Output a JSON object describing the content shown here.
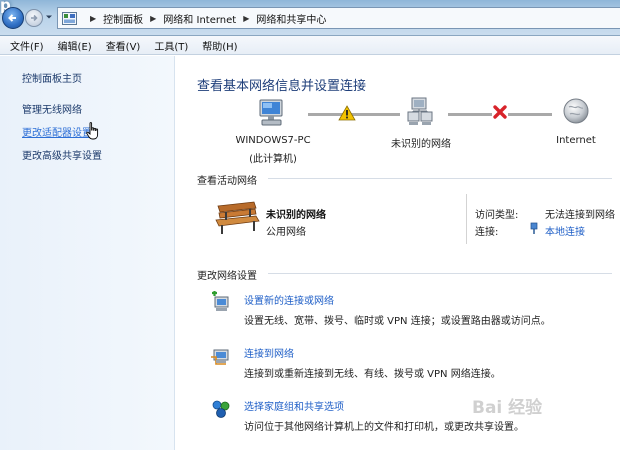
{
  "window": {
    "title_fragment": "p"
  },
  "address_bar": {
    "crumbs": [
      "控制面板",
      "网络和 Internet",
      "网络和共享中心"
    ],
    "icons": [
      "back-arrow-icon",
      "forward-arrow-icon",
      "control-panel-icon"
    ]
  },
  "menu": {
    "items": [
      "文件(F)",
      "编辑(E)",
      "查看(V)",
      "工具(T)",
      "帮助(H)"
    ]
  },
  "sidebar": {
    "items": [
      {
        "label": "控制面板主页"
      },
      {
        "label": "管理无线网络"
      },
      {
        "label": "更改适配器设置",
        "hovered": true
      },
      {
        "label": "更改高级共享设置"
      }
    ]
  },
  "main": {
    "title": "查看基本网络信息并设置连接",
    "map": {
      "nodes": [
        {
          "line1": "WINDOWS7-PC",
          "line2": "(此计算机)",
          "icon": "computer-icon"
        },
        {
          "line1": "未识别的网络",
          "icon": "network-icon"
        },
        {
          "line1": "Internet",
          "icon": "globe-icon"
        }
      ],
      "link_status": [
        {
          "icon": "warning-icon",
          "color": "#f2c200"
        },
        {
          "icon": "error-x-icon",
          "color": "#d8232a"
        }
      ]
    },
    "active": {
      "heading": "查看活动网络",
      "network_name": "未识别的网络",
      "network_type": "公用网络",
      "access_label": "访问类型:",
      "access_value": "无法连接到网络",
      "conn_label": "连接:",
      "conn_value": "本地连接"
    },
    "settings": {
      "heading": "更改网络设置",
      "tasks": [
        {
          "link": "设置新的连接或网络",
          "desc": "设置无线、宽带、拨号、临时或 VPN 连接；或设置路由器或访问点。",
          "icon": "new-connection-icon"
        },
        {
          "link": "连接到网络",
          "desc": "连接到或重新连接到无线、有线、拨号或 VPN 网络连接。",
          "icon": "connect-network-icon"
        },
        {
          "link": "选择家庭组和共享选项",
          "desc": "访问位于其他网络计算机上的文件和打印机，或更改共享设置。",
          "icon": "homegroup-icon"
        }
      ]
    }
  },
  "watermark": "Bai 经验"
}
